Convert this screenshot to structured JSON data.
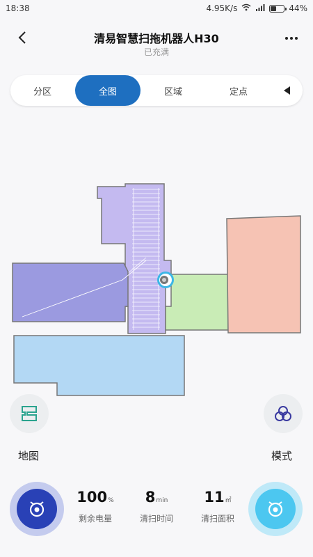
{
  "statusbar": {
    "time": "18:38",
    "speed": "4.95K/s",
    "battery": "44%",
    "battery_level": 0.44
  },
  "header": {
    "title": "清易智慧扫拖机器人H30",
    "subtitle": "已充满"
  },
  "tabs": [
    {
      "label": "分区"
    },
    {
      "label": "全图",
      "active": true
    },
    {
      "label": "区域"
    },
    {
      "label": "定点"
    }
  ],
  "map_colors": {
    "purple": "#c4baf0",
    "deep_purple": "#9b9ae0",
    "blue": "#b3d8f4",
    "green": "#c9ecb6",
    "salmon": "#f6c3b4",
    "robot": "#3cb7e6"
  },
  "side": {
    "map_label": "地图",
    "mode_label": "模式"
  },
  "stats": [
    {
      "value": "100",
      "unit": "%",
      "label": "剩余电量"
    },
    {
      "value": "8",
      "unit": "min",
      "label": "清扫时间"
    },
    {
      "value": "11",
      "unit": "㎡",
      "label": "清扫面积"
    }
  ],
  "colors": {
    "accent": "#1e6fc0",
    "left_button": "#2941b6",
    "right_button": "#4cc7f0"
  }
}
